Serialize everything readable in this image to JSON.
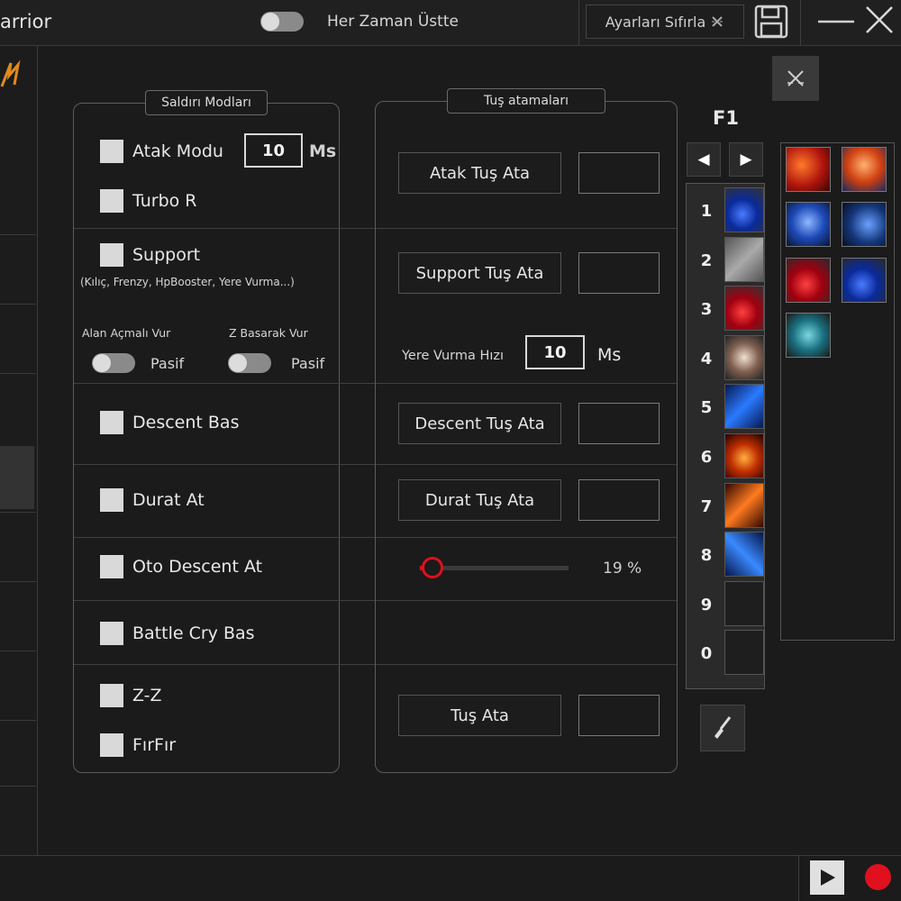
{
  "titlebar": {
    "app_title": "arrior",
    "always_on_top_label": "Her Zaman Üstte",
    "reset_label": "Ayarları Sıfırla",
    "reset_icon": "cross-icon",
    "save_icon": "floppy-save-icon",
    "minimize_icon": "minimize-icon",
    "close_icon": "close-icon"
  },
  "attack_modes": {
    "legend": "Saldırı Modları",
    "atak_modu": "Atak Modu",
    "atak_ms_value": "10",
    "ms_unit": "Ms",
    "turbo_r": "Turbo R",
    "support": "Support",
    "support_note": "(Kılıç, Frenzy, HpBooster, Yere Vurma...)",
    "alan_acmali_vur": "Alan Açmalı Vur",
    "z_basarak_vur": "Z Basarak Vur",
    "pasif_1": "Pasif",
    "pasif_2": "Pasif",
    "descent_bas": "Descent Bas",
    "durat_at": "Durat At",
    "oto_descent_at": "Oto Descent At",
    "battle_cry_bas": "Battle Cry Bas",
    "z_z": "Z-Z",
    "firfir": "FırFır"
  },
  "key_bindings": {
    "legend": "Tuş atamaları",
    "atak_tus_ata": "Atak Tuş Ata",
    "support_tus_ata": "Support Tuş Ata",
    "yere_vurma_hizi": "Yere Vurma Hızı",
    "yere_vurma_value": "10",
    "ms_unit": "Ms",
    "descent_tus_ata": "Descent Tuş Ata",
    "durat_tus_ata": "Durat Tuş Ata",
    "slider_percent": "19 %",
    "slider_value": 0.19,
    "tus_ata": "Tuş Ata"
  },
  "skillbar": {
    "page_label": "F1",
    "prev_icon": "left-arrow-icon",
    "next_icon": "right-arrow-icon",
    "slots": [
      {
        "num": "1",
        "icon": "blue-potion-icon"
      },
      {
        "num": "2",
        "icon": "crossed-swords-icon"
      },
      {
        "num": "3",
        "icon": "red-potion-icon"
      },
      {
        "num": "4",
        "icon": "tiger-icon"
      },
      {
        "num": "5",
        "icon": "blue-slash-icon"
      },
      {
        "num": "6",
        "icon": "fire-bell-icon"
      },
      {
        "num": "7",
        "icon": "orange-slash-icon"
      },
      {
        "num": "8",
        "icon": "blue-claw-icon"
      },
      {
        "num": "9",
        "icon": ""
      },
      {
        "num": "0",
        "icon": ""
      }
    ],
    "brush_icon": "brush-icon"
  },
  "inventory_icons": [
    "red-slash-skill-icon",
    "fire-warrior-skill-icon",
    "blue-body-skill-icon",
    "blue-shield-skill-icon",
    "red-potion-skill-icon",
    "blue-potion-skill-icon",
    "teal-jar-skill-icon"
  ],
  "colors": {
    "background": "#1b1b1b",
    "slider_accent": "#e0101e",
    "record_red": "#e0101e",
    "logo_orange": "#e08a1e"
  },
  "bottombar": {
    "play_icon": "play-icon",
    "record_icon": "record-icon"
  }
}
